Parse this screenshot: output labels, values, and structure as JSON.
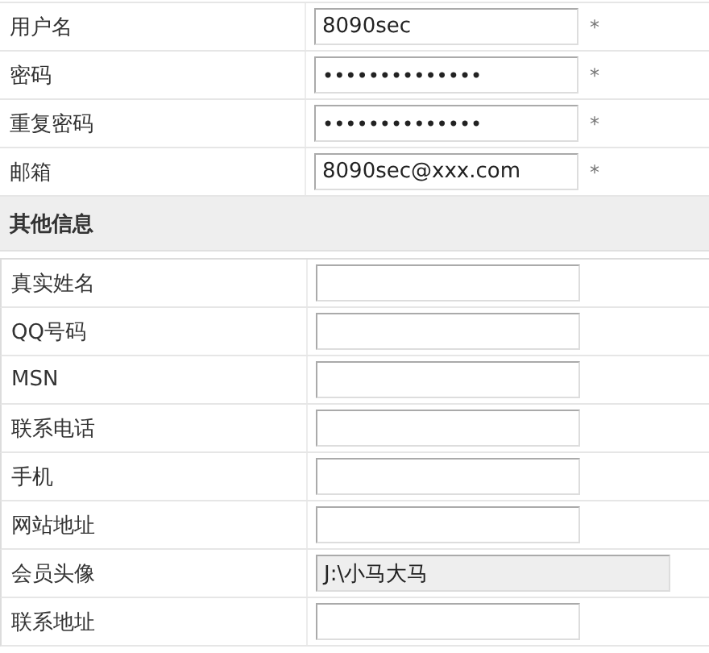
{
  "account": {
    "rows": [
      {
        "label": "用户名",
        "kind": "text",
        "value": "8090sec",
        "mark": "*"
      },
      {
        "label": "密码",
        "kind": "password",
        "value": "••••••••••••••",
        "mark": "*"
      },
      {
        "label": "重复密码",
        "kind": "password",
        "value": "••••••••••••••",
        "mark": "*"
      },
      {
        "label": "邮箱",
        "kind": "text",
        "value": "8090sec@xxx.com",
        "mark": "*"
      }
    ]
  },
  "other": {
    "title": "其他信息",
    "rows": [
      {
        "label": "真实姓名",
        "kind": "text"
      },
      {
        "label": "QQ号码",
        "kind": "text"
      },
      {
        "label": "MSN",
        "kind": "text"
      },
      {
        "label": "联系电话",
        "kind": "text"
      },
      {
        "label": "手机",
        "kind": "text"
      },
      {
        "label": "网站地址",
        "kind": "text"
      },
      {
        "label": "会员头像",
        "kind": "file",
        "value": "J:\\小马大马"
      },
      {
        "label": "联系地址",
        "kind": "text"
      }
    ]
  }
}
